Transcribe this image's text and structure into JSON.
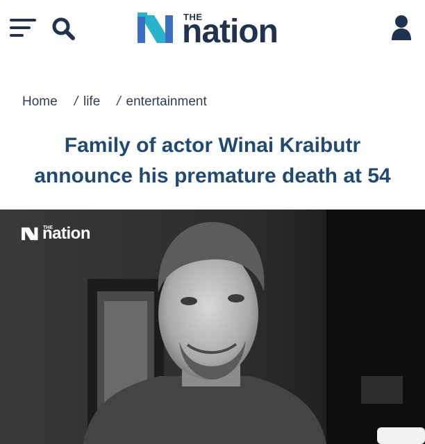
{
  "header": {
    "logo_the": "THE",
    "logo_word": "nation",
    "menu_icon": "hamburger-menu-icon",
    "search_icon": "search-icon",
    "user_icon": "user-account-icon"
  },
  "breadcrumb": {
    "items": [
      {
        "label": "Home"
      },
      {
        "label": "life"
      },
      {
        "label": "entertainment"
      }
    ],
    "separator": "/"
  },
  "article": {
    "title": "Family of actor Winai Kraibutr announce his premature death at 54"
  },
  "hero_image": {
    "watermark_the": "THE",
    "watermark_word": "nation"
  },
  "colors": {
    "brand_navy": "#1f3350",
    "title_blue": "#1f4a75",
    "logo_blue": "#3b6fc4",
    "logo_teal": "#29b3c9"
  }
}
